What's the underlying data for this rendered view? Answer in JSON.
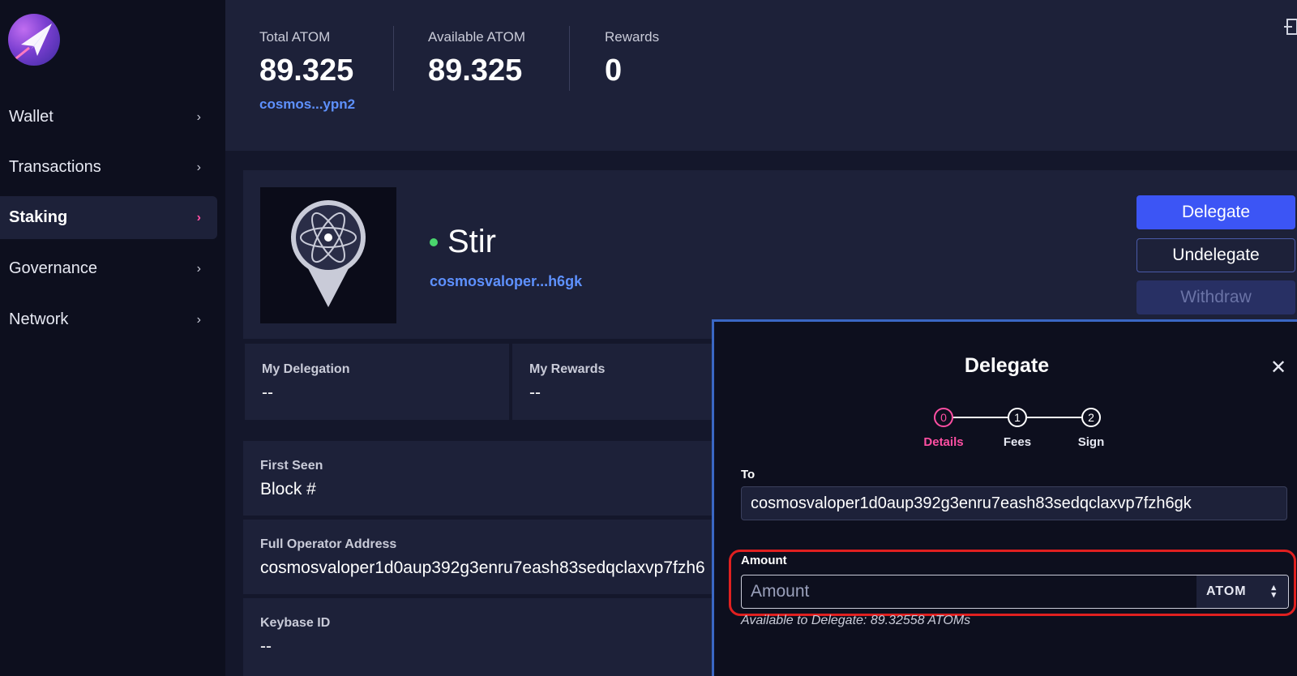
{
  "sidebar": {
    "items": [
      {
        "label": "Wallet"
      },
      {
        "label": "Transactions"
      },
      {
        "label": "Staking"
      },
      {
        "label": "Governance"
      },
      {
        "label": "Network"
      }
    ]
  },
  "header": {
    "total_label": "Total ATOM",
    "total_value": "89.325",
    "address": "cosmos...ypn2",
    "available_label": "Available ATOM",
    "available_value": "89.325",
    "rewards_label": "Rewards",
    "rewards_value": "0"
  },
  "validator": {
    "name": "Stir",
    "address_short": "cosmosvaloper...h6gk",
    "status_color": "#4ad66d"
  },
  "actions": {
    "delegate": "Delegate",
    "undelegate": "Undelegate",
    "withdraw": "Withdraw"
  },
  "stats": {
    "my_delegation_label": "My Delegation",
    "my_delegation_value": "--",
    "my_rewards_label": "My Rewards",
    "my_rewards_value": "--"
  },
  "details": {
    "first_seen_label": "First Seen",
    "first_seen_value": "Block #",
    "operator_label": "Full Operator Address",
    "operator_value": "cosmosvaloper1d0aup392g3enru7eash83sedqclaxvp7fzh6",
    "keybase_label": "Keybase ID",
    "keybase_value": "--"
  },
  "modal": {
    "title": "Delegate",
    "steps": [
      {
        "number": "0",
        "label": "Details"
      },
      {
        "number": "1",
        "label": "Fees"
      },
      {
        "number": "2",
        "label": "Sign"
      }
    ],
    "to_label": "To",
    "to_value": "cosmosvaloper1d0aup392g3enru7eash83sedqclaxvp7fzh6gk",
    "amount_label": "Amount",
    "amount_placeholder": "Amount",
    "unit": "ATOM",
    "available": "Available to Delegate: 89.32558 ATOMs"
  },
  "colors": {
    "accent": "#3c55f5",
    "link": "#5e91ff",
    "active_step": "#ff4fa3",
    "highlight": "#e02020"
  },
  "icons": [
    "app-logo-icon",
    "chevron-right-icon",
    "exit-icon",
    "cosmos-atom-icon",
    "close-icon",
    "select-arrows-icon"
  ]
}
